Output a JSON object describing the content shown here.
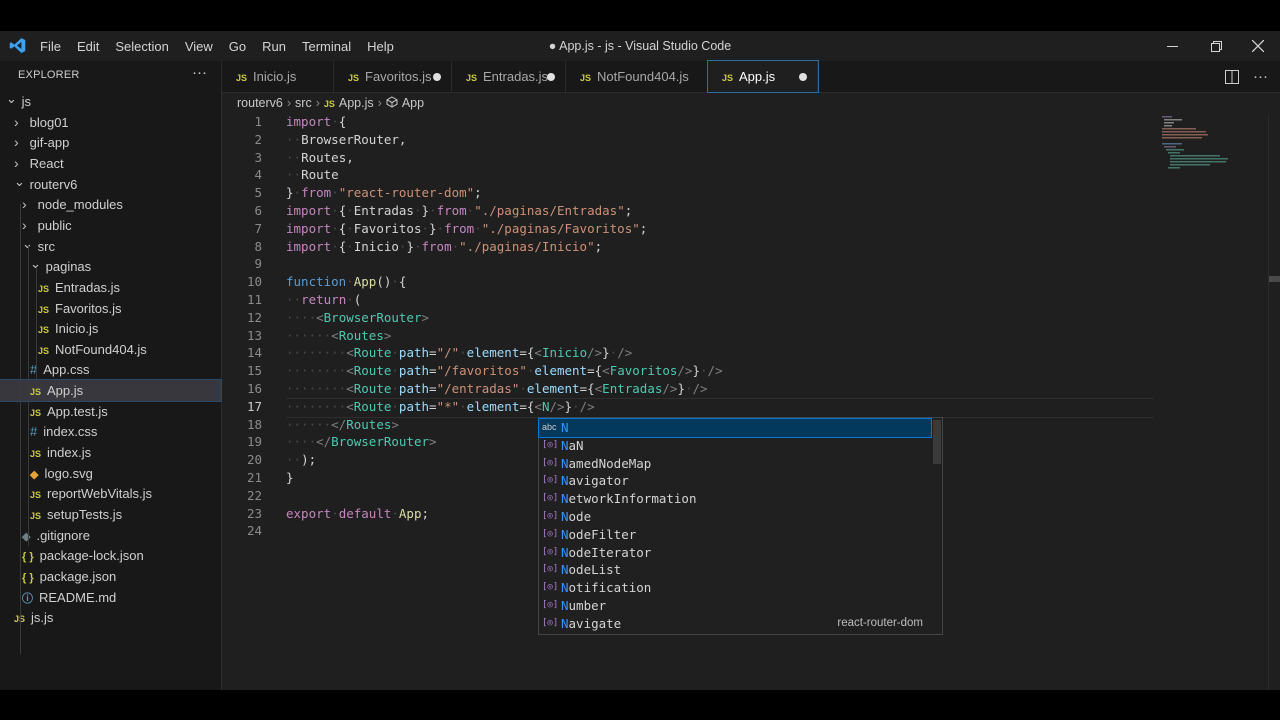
{
  "window": {
    "title": "● App.js - js - Visual Studio Code",
    "menu": [
      "File",
      "Edit",
      "Selection",
      "View",
      "Go",
      "Run",
      "Terminal",
      "Help"
    ]
  },
  "sidebar": {
    "title": "EXPLORER",
    "more": "···",
    "tree": [
      {
        "label": "js",
        "depth": 0,
        "kind": "folder",
        "open": true
      },
      {
        "label": "blog01",
        "depth": 1,
        "kind": "folder",
        "open": false
      },
      {
        "label": "gif-app",
        "depth": 1,
        "kind": "folder",
        "open": false
      },
      {
        "label": "React",
        "depth": 1,
        "kind": "folder",
        "open": false
      },
      {
        "label": "routerv6",
        "depth": 1,
        "kind": "folder",
        "open": true
      },
      {
        "label": "node_modules",
        "depth": 2,
        "kind": "folder",
        "open": false
      },
      {
        "label": "public",
        "depth": 2,
        "kind": "folder",
        "open": false
      },
      {
        "label": "src",
        "depth": 2,
        "kind": "folder",
        "open": true
      },
      {
        "label": "paginas",
        "depth": 3,
        "kind": "folder",
        "open": true
      },
      {
        "label": "Entradas.js",
        "depth": 4,
        "kind": "js"
      },
      {
        "label": "Favoritos.js",
        "depth": 4,
        "kind": "js"
      },
      {
        "label": "Inicio.js",
        "depth": 4,
        "kind": "js"
      },
      {
        "label": "NotFound404.js",
        "depth": 4,
        "kind": "js"
      },
      {
        "label": "App.css",
        "depth": 3,
        "kind": "css"
      },
      {
        "label": "App.js",
        "depth": 3,
        "kind": "js",
        "selected": true
      },
      {
        "label": "App.test.js",
        "depth": 3,
        "kind": "js"
      },
      {
        "label": "index.css",
        "depth": 3,
        "kind": "css"
      },
      {
        "label": "index.js",
        "depth": 3,
        "kind": "js"
      },
      {
        "label": "logo.svg",
        "depth": 3,
        "kind": "svg"
      },
      {
        "label": "reportWebVitals.js",
        "depth": 3,
        "kind": "js"
      },
      {
        "label": "setupTests.js",
        "depth": 3,
        "kind": "js"
      },
      {
        "label": ".gitignore",
        "depth": 2,
        "kind": "git"
      },
      {
        "label": "package-lock.json",
        "depth": 2,
        "kind": "json"
      },
      {
        "label": "package.json",
        "depth": 2,
        "kind": "json"
      },
      {
        "label": "README.md",
        "depth": 2,
        "kind": "info"
      },
      {
        "label": "js.js",
        "depth": 1,
        "kind": "js"
      }
    ]
  },
  "tabs": [
    {
      "label": "Inicio.js",
      "dirty": false,
      "active": false
    },
    {
      "label": "Favoritos.js",
      "dirty": true,
      "active": false
    },
    {
      "label": "Entradas.js",
      "dirty": true,
      "active": false
    },
    {
      "label": "NotFound404.js",
      "dirty": false,
      "active": false
    },
    {
      "label": "App.js",
      "dirty": true,
      "active": true
    }
  ],
  "breadcrumb": [
    "routerv6",
    "src",
    "App.js",
    "App"
  ],
  "editor": {
    "current_line": 17,
    "lines": [
      [
        [
          "k",
          "import"
        ],
        [
          "ws",
          "·"
        ],
        [
          "p",
          "{"
        ]
      ],
      [
        [
          "ws",
          "··"
        ],
        [
          "p",
          "BrowserRouter,"
        ]
      ],
      [
        [
          "ws",
          "··"
        ],
        [
          "p",
          "Routes,"
        ]
      ],
      [
        [
          "ws",
          "··"
        ],
        [
          "p",
          "Route"
        ]
      ],
      [
        [
          "p",
          "}"
        ],
        [
          "ws",
          "·"
        ],
        [
          "k",
          "from"
        ],
        [
          "ws",
          "·"
        ],
        [
          "s",
          "\"react-router-dom\""
        ],
        [
          "p",
          ";"
        ]
      ],
      [
        [
          "k",
          "import"
        ],
        [
          "ws",
          "·"
        ],
        [
          "p",
          "{"
        ],
        [
          "ws",
          "·"
        ],
        [
          "p",
          "Entradas"
        ],
        [
          "ws",
          "·"
        ],
        [
          "p",
          "}"
        ],
        [
          "ws",
          "·"
        ],
        [
          "k",
          "from"
        ],
        [
          "ws",
          "·"
        ],
        [
          "s",
          "\"./paginas/Entradas\""
        ],
        [
          "p",
          ";"
        ]
      ],
      [
        [
          "k",
          "import"
        ],
        [
          "ws",
          "·"
        ],
        [
          "p",
          "{"
        ],
        [
          "ws",
          "·"
        ],
        [
          "p",
          "Favoritos"
        ],
        [
          "ws",
          "·"
        ],
        [
          "p",
          "}"
        ],
        [
          "ws",
          "·"
        ],
        [
          "k",
          "from"
        ],
        [
          "ws",
          "·"
        ],
        [
          "s",
          "\"./paginas/Favoritos\""
        ],
        [
          "p",
          ";"
        ]
      ],
      [
        [
          "k",
          "import"
        ],
        [
          "ws",
          "·"
        ],
        [
          "p",
          "{"
        ],
        [
          "ws",
          "·"
        ],
        [
          "p",
          "Inicio"
        ],
        [
          "ws",
          "·"
        ],
        [
          "p",
          "}"
        ],
        [
          "ws",
          "·"
        ],
        [
          "k",
          "from"
        ],
        [
          "ws",
          "·"
        ],
        [
          "s",
          "\"./paginas/Inicio\""
        ],
        [
          "p",
          ";"
        ]
      ],
      [],
      [
        [
          "kw",
          "function"
        ],
        [
          "ws",
          "·"
        ],
        [
          "fn",
          "App"
        ],
        [
          "p",
          "()"
        ],
        [
          "ws",
          "·"
        ],
        [
          "p",
          "{"
        ]
      ],
      [
        [
          "ws",
          "··"
        ],
        [
          "k",
          "return"
        ],
        [
          "ws",
          "·"
        ],
        [
          "p",
          "("
        ]
      ],
      [
        [
          "ws",
          "····"
        ],
        [
          "tg",
          "<"
        ],
        [
          "t",
          "BrowserRouter"
        ],
        [
          "tg",
          ">"
        ]
      ],
      [
        [
          "ws",
          "······"
        ],
        [
          "tg",
          "<"
        ],
        [
          "t",
          "Routes"
        ],
        [
          "tg",
          ">"
        ]
      ],
      [
        [
          "ws",
          "········"
        ],
        [
          "tg",
          "<"
        ],
        [
          "t",
          "Route"
        ],
        [
          "ws",
          "·"
        ],
        [
          "at",
          "path"
        ],
        [
          "p",
          "="
        ],
        [
          "s",
          "\"/\""
        ],
        [
          "ws",
          "·"
        ],
        [
          "at",
          "element"
        ],
        [
          "p",
          "={"
        ],
        [
          "tg",
          "<"
        ],
        [
          "t",
          "Inicio"
        ],
        [
          "tg",
          "/>"
        ],
        [
          "p",
          "}"
        ],
        [
          "ws",
          "·"
        ],
        [
          "tg",
          "/>"
        ]
      ],
      [
        [
          "ws",
          "········"
        ],
        [
          "tg",
          "<"
        ],
        [
          "t",
          "Route"
        ],
        [
          "ws",
          "·"
        ],
        [
          "at",
          "path"
        ],
        [
          "p",
          "="
        ],
        [
          "s",
          "\"/favoritos\""
        ],
        [
          "ws",
          "·"
        ],
        [
          "at",
          "element"
        ],
        [
          "p",
          "={"
        ],
        [
          "tg",
          "<"
        ],
        [
          "t",
          "Favoritos"
        ],
        [
          "tg",
          "/>"
        ],
        [
          "p",
          "}"
        ],
        [
          "ws",
          "·"
        ],
        [
          "tg",
          "/>"
        ]
      ],
      [
        [
          "ws",
          "········"
        ],
        [
          "tg",
          "<"
        ],
        [
          "t",
          "Route"
        ],
        [
          "ws",
          "·"
        ],
        [
          "at",
          "path"
        ],
        [
          "p",
          "="
        ],
        [
          "s",
          "\"/entradas\""
        ],
        [
          "ws",
          "·"
        ],
        [
          "at",
          "element"
        ],
        [
          "p",
          "={"
        ],
        [
          "tg",
          "<"
        ],
        [
          "t",
          "Entradas"
        ],
        [
          "tg",
          "/>"
        ],
        [
          "p",
          "}"
        ],
        [
          "ws",
          "·"
        ],
        [
          "tg",
          "/>"
        ]
      ],
      [
        [
          "ws",
          "········"
        ],
        [
          "tg",
          "<"
        ],
        [
          "t",
          "Route"
        ],
        [
          "ws",
          "·"
        ],
        [
          "at",
          "path"
        ],
        [
          "p",
          "="
        ],
        [
          "s",
          "\"*\""
        ],
        [
          "ws",
          "·"
        ],
        [
          "at",
          "element"
        ],
        [
          "p",
          "={"
        ],
        [
          "tg",
          "<"
        ],
        [
          "t",
          "N"
        ],
        [
          "tg",
          "/>"
        ],
        [
          "p",
          "}"
        ],
        [
          "ws",
          "·"
        ],
        [
          "tg",
          "/>"
        ]
      ],
      [
        [
          "ws",
          "······"
        ],
        [
          "tg",
          "</"
        ],
        [
          "t",
          "Routes"
        ],
        [
          "tg",
          ">"
        ]
      ],
      [
        [
          "ws",
          "····"
        ],
        [
          "tg",
          "</"
        ],
        [
          "t",
          "BrowserRouter"
        ],
        [
          "tg",
          ">"
        ]
      ],
      [
        [
          "ws",
          "··"
        ],
        [
          "p",
          ");"
        ]
      ],
      [
        [
          "p",
          "}"
        ]
      ],
      [],
      [
        [
          "k",
          "export"
        ],
        [
          "ws",
          "·"
        ],
        [
          "k",
          "default"
        ],
        [
          "ws",
          "·"
        ],
        [
          "fn",
          "App"
        ],
        [
          "p",
          ";"
        ]
      ],
      []
    ]
  },
  "suggest": {
    "items": [
      {
        "label": "N",
        "kind": "abc",
        "focused": true
      },
      {
        "label": "NaN",
        "kind": "var"
      },
      {
        "label": "NamedNodeMap",
        "kind": "var"
      },
      {
        "label": "Navigator",
        "kind": "var"
      },
      {
        "label": "NetworkInformation",
        "kind": "var"
      },
      {
        "label": "Node",
        "kind": "var"
      },
      {
        "label": "NodeFilter",
        "kind": "var"
      },
      {
        "label": "NodeIterator",
        "kind": "var"
      },
      {
        "label": "NodeList",
        "kind": "var"
      },
      {
        "label": "Notification",
        "kind": "var"
      },
      {
        "label": "Number",
        "kind": "var"
      },
      {
        "label": "Navigate",
        "kind": "var",
        "detail": "react-router-dom"
      }
    ]
  }
}
